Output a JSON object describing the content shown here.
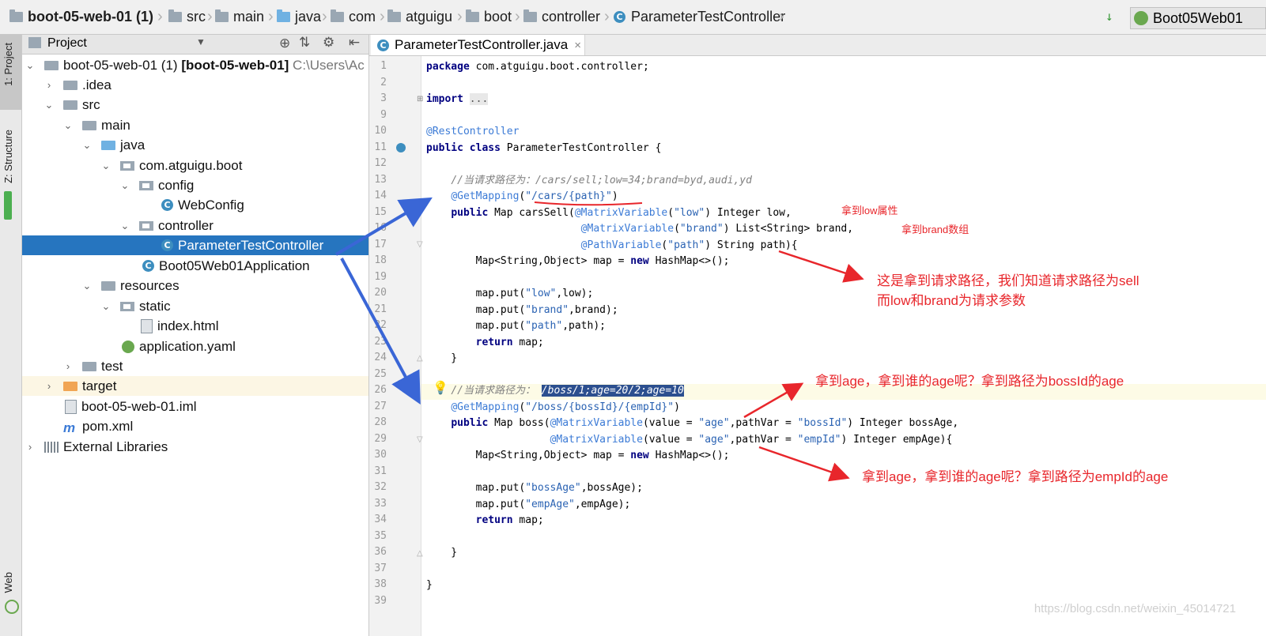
{
  "breadcrumb": {
    "project": "boot-05-web-01 (1)",
    "items": [
      "src",
      "main",
      "java",
      "com",
      "atguigu",
      "boot",
      "controller",
      "ParameterTestController"
    ]
  },
  "run_config": "Boot05Web01",
  "tool_strip": {
    "project_tab": "1: Project",
    "structure_tab": "Z: Structure",
    "web_tab": "Web"
  },
  "project_panel": {
    "title": "Project",
    "tree": [
      {
        "label": "boot-05-web-01 (1)",
        "bold": "[boot-05-web-01]",
        "path": "C:\\Users\\Ac"
      },
      {
        "label": ".idea"
      },
      {
        "label": "src"
      },
      {
        "label": "main"
      },
      {
        "label": "java"
      },
      {
        "label": "com.atguigu.boot"
      },
      {
        "label": "config"
      },
      {
        "label": "WebConfig"
      },
      {
        "label": "controller"
      },
      {
        "label": "ParameterTestController"
      },
      {
        "label": "Boot05Web01Application"
      },
      {
        "label": "resources"
      },
      {
        "label": "static"
      },
      {
        "label": "index.html"
      },
      {
        "label": "application.yaml"
      },
      {
        "label": "test"
      },
      {
        "label": "target"
      },
      {
        "label": "boot-05-web-01.iml"
      },
      {
        "label": "pom.xml"
      },
      {
        "label": "External Libraries"
      }
    ]
  },
  "editor": {
    "tab_label": "ParameterTestController.java",
    "line_numbers": [
      "1",
      "2",
      "3",
      "9",
      "10",
      "11",
      "12",
      "13",
      "14",
      "15",
      "16",
      "17",
      "18",
      "19",
      "20",
      "21",
      "22",
      "23",
      "24",
      "25",
      "26",
      "27",
      "28",
      "29",
      "30",
      "31",
      "32",
      "33",
      "34",
      "35",
      "36",
      "37",
      "38",
      "39"
    ]
  },
  "annotations": {
    "low": "拿到low属性",
    "brand": "拿到brand数组",
    "path_note_1": "这是拿到请求路径，我们知道请求路径为sell",
    "path_note_2": "而low和brand为请求参数",
    "boss_note": "拿到age，拿到谁的age呢？拿到路径为bossId的age",
    "emp_note": "拿到age，拿到谁的age呢？拿到路径为empId的age"
  },
  "watermark": "https://blog.csdn.net/weixin_45014721",
  "colors": {
    "selection": "#2675bf",
    "annotation_red": "#e8262b",
    "arrow_blue": "#3a66d6"
  }
}
